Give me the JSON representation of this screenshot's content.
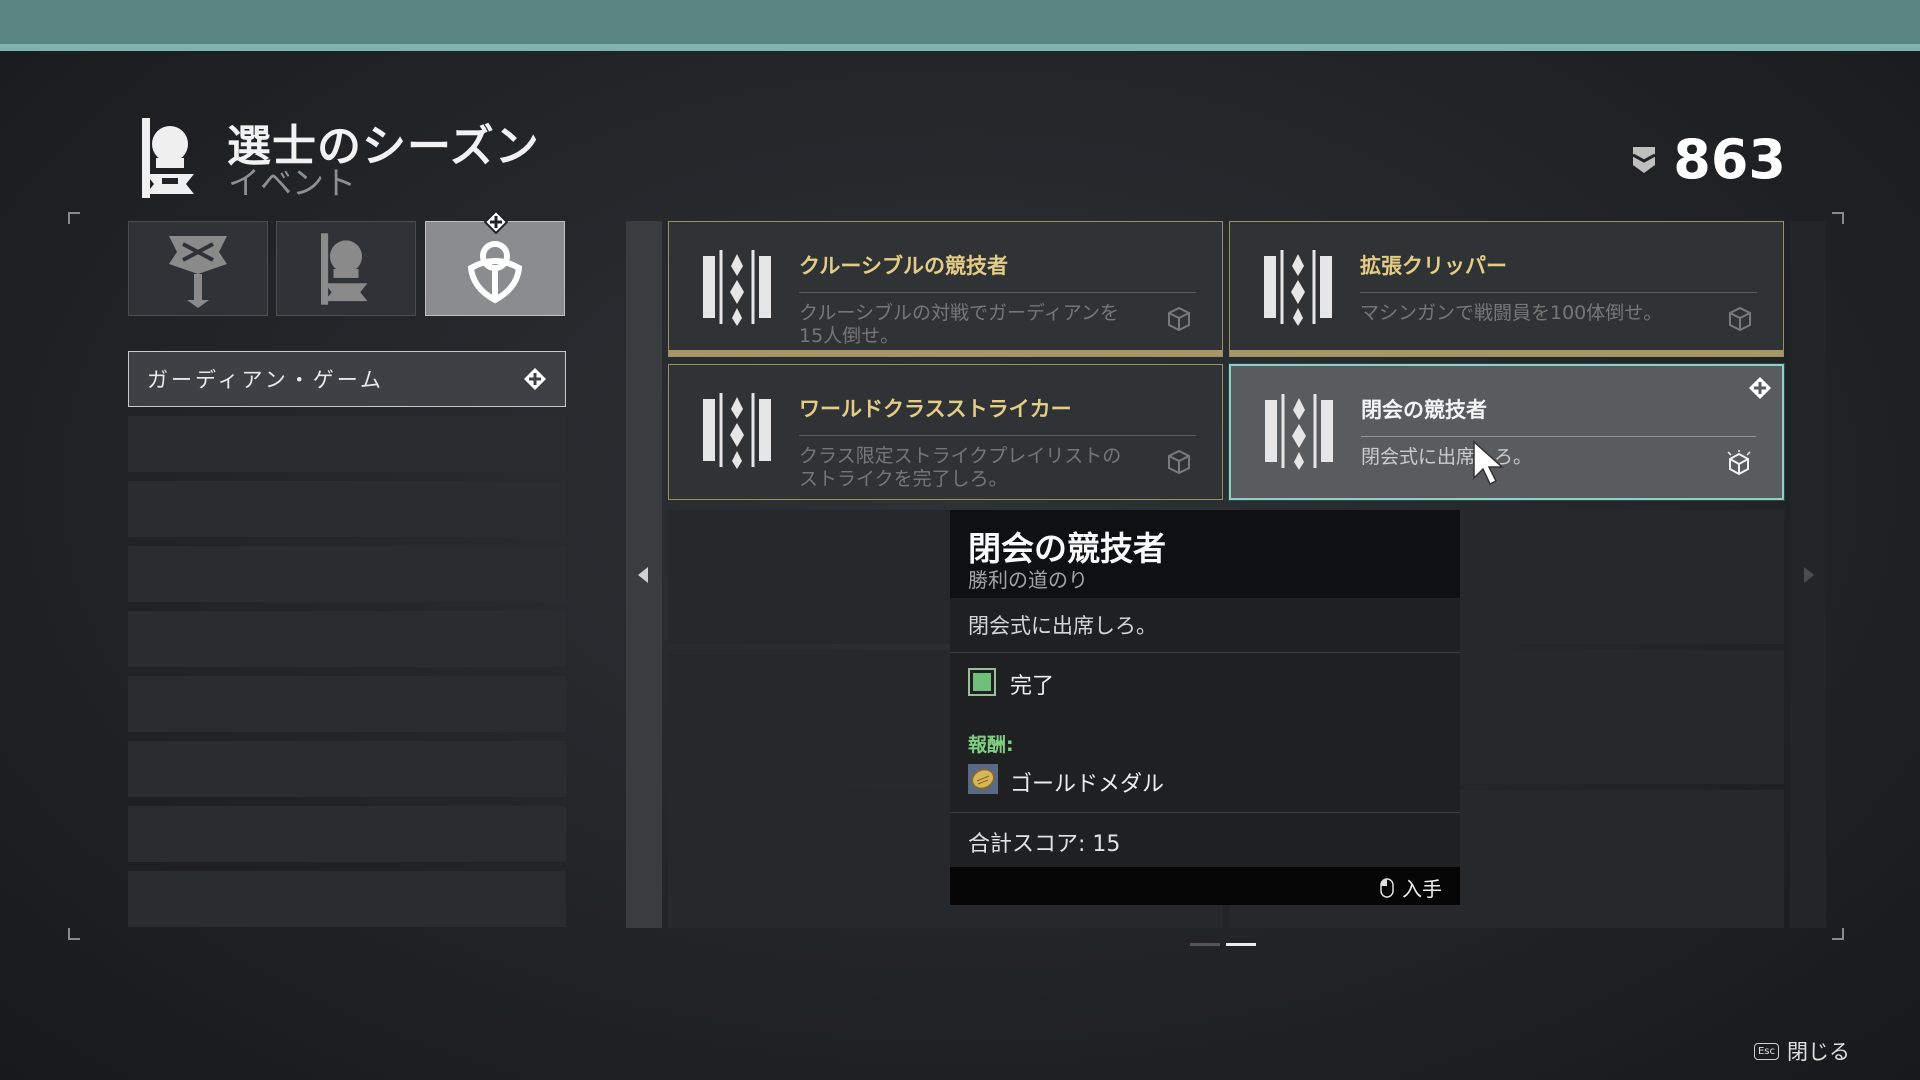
{
  "header": {
    "title": "選士のシーズン",
    "subtitle": "イベント",
    "currency_icon": "bright-dust-icon",
    "currency_value": "863"
  },
  "category_tabs": [
    {
      "icon": "crucible-emblem-icon",
      "active": false
    },
    {
      "icon": "guardian-games-emblem-icon",
      "active": false
    },
    {
      "icon": "laurel-emblem-icon",
      "active": true
    }
  ],
  "sidebar": {
    "selected_item": "ガーディアン・ゲーム",
    "empty_rows": 8
  },
  "triumphs": [
    {
      "title": "クルーシブルの競技者",
      "desc": "クルーシブルの対戦でガーディアンを15人倒せ。",
      "state": "in-progress",
      "icon": "triumph-seal-icon"
    },
    {
      "title": "拡張クリッパー",
      "desc": "マシンガンで戦闘員を100体倒せ。",
      "state": "in-progress",
      "icon": "triumph-seal-icon"
    },
    {
      "title": "ワールドクラスストライカー",
      "desc": "クラス限定ストライクプレイリストのストライクを完了しろ。",
      "state": "normal",
      "icon": "triumph-seal-icon"
    },
    {
      "title": "閉会の競技者",
      "desc": "閉会式に出席しろ。",
      "state": "selected",
      "icon": "triumph-seal-icon"
    }
  ],
  "tooltip": {
    "title": "閉会の競技者",
    "subtitle": "勝利の道のり",
    "description": "閉会式に出席しろ。",
    "objective_label": "完了",
    "objective_complete": true,
    "reward_label": "報酬:",
    "reward_item": "ゴールドメダル",
    "total_score": "合計スコア: 15",
    "action_label": "入手"
  },
  "footer": {
    "esc_key": "Esc",
    "close_label": "閉じる"
  },
  "colors": {
    "accent_teal": "#8fd0c6",
    "gold": "#e4cc85",
    "reward_green": "#7fcf83"
  }
}
